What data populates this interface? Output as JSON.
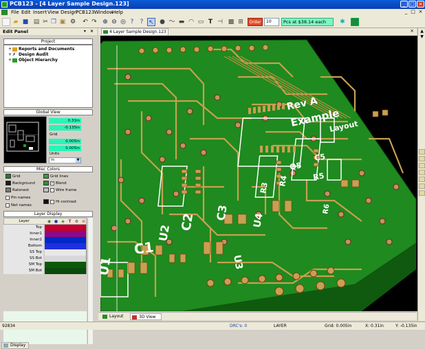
{
  "window": {
    "app_name": "PCB123",
    "title": "PCB123 - [4 Layer Sample Design.123]"
  },
  "menu": {
    "items": [
      "File",
      "Edit",
      "Insert",
      "View",
      "Design",
      "PCB123",
      "Window",
      "Help"
    ],
    "doc_controls": [
      "_",
      "□",
      "×"
    ]
  },
  "toolbar": {
    "order_label": "Order",
    "quantity": "10",
    "price_text": "Pcs at $38.14 each",
    "icons": [
      "new-icon",
      "open-icon",
      "save-icon",
      "print-icon",
      "cut-icon",
      "copy-icon",
      "paste-icon",
      "library-icon",
      "undo-icon",
      "redo-icon",
      "zoom-in-icon",
      "zoom-out-icon",
      "zoom-fit-icon",
      "help-icon",
      "select-arrow-icon",
      "via-icon",
      "trace-icon",
      "pad-icon",
      "arc-icon",
      "rect-icon",
      "text-icon",
      "dimension-icon",
      "component-icon",
      "settings-icon",
      "status-indicator-icon"
    ]
  },
  "edit_panel": {
    "title": "Edit Panel",
    "project": {
      "title": "Project",
      "items": [
        {
          "label": "Reports and Documents",
          "toggle": "+"
        },
        {
          "label": "Design Audit",
          "toggle": "+"
        },
        {
          "label": "Object Hierarchy",
          "toggle": "+"
        }
      ]
    },
    "global_view": {
      "title": "Global View",
      "x_value": "0.31in",
      "y_value": "-0.135in",
      "grid_label": "Grid",
      "grid_x": "0.005in",
      "grid_y": "0.005in",
      "units_label": "Units",
      "units_value": "in"
    },
    "misc_colors": {
      "title": "Misc Colors",
      "items": [
        {
          "label": "Grid",
          "color": "#2a7a2a",
          "checked": null
        },
        {
          "label": "Grid lines",
          "color": "#3c9a3c",
          "checked": null
        },
        {
          "label": "Background",
          "color": "#1a1a1a",
          "checked": null
        },
        {
          "label": "Blend",
          "color": null,
          "checked": true
        },
        {
          "label": "Ratsnest",
          "color": "#7a7a7a",
          "checked": null
        },
        {
          "label": "Wire frame",
          "color": null,
          "checked": false
        },
        {
          "label": "Pin names",
          "color": null,
          "checked": false
        },
        {
          "label": "Hi contrast",
          "color": null,
          "checked": false
        },
        {
          "label": "Net names",
          "color": null,
          "checked": false
        }
      ]
    },
    "layer_display": {
      "title": "Layer Display",
      "header": "Layer",
      "layers": [
        {
          "name": "Top",
          "color": "#c4002a"
        },
        {
          "name": "Inner1",
          "color": "#8a0a8a"
        },
        {
          "name": "Inner2",
          "color": "#0028c8"
        },
        {
          "name": "Bottom",
          "color": "#1f2fe0"
        },
        {
          "name": "SS Top",
          "color": "#e8e8e8"
        },
        {
          "name": "SS Bot",
          "color": "#d8d8d8"
        },
        {
          "name": "SM Top",
          "color": "#0a5a0a"
        },
        {
          "name": "SM Bot",
          "color": "#0a4a0a"
        }
      ]
    },
    "display_tab": "Display"
  },
  "document": {
    "tab_label": "4 Layer Sample Design.123",
    "view_tabs": [
      "Layout",
      "3D View"
    ],
    "board": {
      "silk_labels": [
        "C1",
        "C2",
        "C3",
        "U1",
        "U2",
        "U3",
        "U4",
        "R3",
        "R4",
        "R5",
        "Q5",
        "C5",
        "R6",
        "Rev A",
        "Example",
        "Layout"
      ]
    }
  },
  "status": {
    "coords": "92834",
    "drc": "DRC's: 0",
    "layer": "LAYER",
    "grid": "Grid: 0.005in",
    "x": "X: 0.31in",
    "y": "Y: -0.135in"
  },
  "colors": {
    "board_green": "#1f8a1f",
    "copper": "#c8a050",
    "silk": "#ffffff",
    "background": "#000000"
  }
}
